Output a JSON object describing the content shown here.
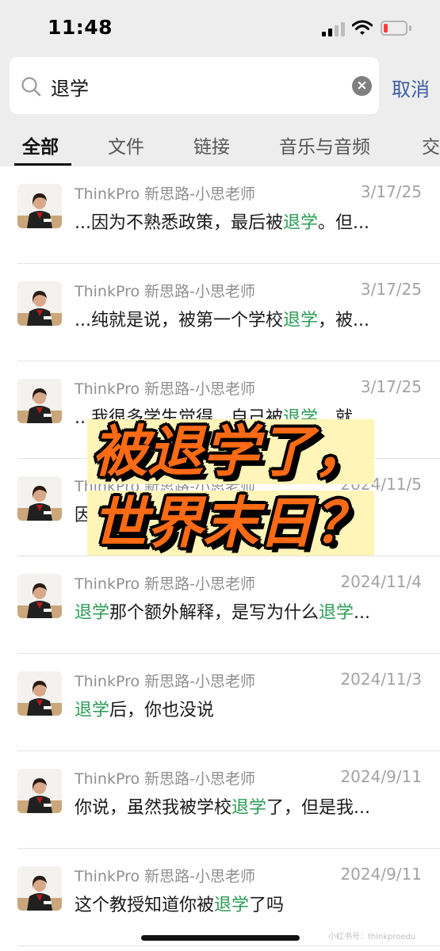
{
  "status_bar": {
    "time": "11:48"
  },
  "search": {
    "query": "退学",
    "cancel_label": "取消"
  },
  "tabs": [
    {
      "label": "全部",
      "active": true
    },
    {
      "label": "文件",
      "active": false
    },
    {
      "label": "链接",
      "active": false
    },
    {
      "label": "音乐与音频",
      "active": false
    },
    {
      "label": "交",
      "active": false
    }
  ],
  "results": [
    {
      "name": "ThinkPro 新思路-小思老师",
      "date": "3/17/25",
      "snippet": [
        {
          "t": "...因为不熟悉政策，最后被"
        },
        {
          "t": "退学",
          "hl": true
        },
        {
          "t": "。但..."
        }
      ]
    },
    {
      "name": "ThinkPro 新思路-小思老师",
      "date": "3/17/25",
      "snippet": [
        {
          "t": "...纯就是说，被第一个学校"
        },
        {
          "t": "退学",
          "hl": true
        },
        {
          "t": "，被..."
        }
      ]
    },
    {
      "name": "ThinkPro 新思路-小思老师",
      "date": "3/17/25",
      "snippet": [
        {
          "t": "...我很多学生觉得，自己被"
        },
        {
          "t": "退学",
          "hl": true
        },
        {
          "t": "，就..."
        }
      ]
    },
    {
      "name": "ThinkPro 新思路-小思老师",
      "date": "2024/11/5",
      "snippet": [
        {
          "t": "因                                          了课"
        }
      ]
    },
    {
      "name": "ThinkPro 新思路-小思老师",
      "date": "2024/11/4",
      "snippet": [
        {
          "t": "退学",
          "hl": true
        },
        {
          "t": "那个额外解释，是写为什么"
        },
        {
          "t": "退学",
          "hl": true
        },
        {
          "t": "..."
        }
      ]
    },
    {
      "name": "ThinkPro 新思路-小思老师",
      "date": "2024/11/3",
      "snippet": [
        {
          "t": "退学",
          "hl": true
        },
        {
          "t": "后，你也没说"
        }
      ]
    },
    {
      "name": "ThinkPro 新思路-小思老师",
      "date": "2024/9/11",
      "snippet": [
        {
          "t": "你说，虽然我被学校"
        },
        {
          "t": "退学",
          "hl": true
        },
        {
          "t": "了，但是我..."
        }
      ]
    },
    {
      "name": "ThinkPro 新思路-小思老师",
      "date": "2024/9/11",
      "snippet": [
        {
          "t": "这个教授知道你被"
        },
        {
          "t": "退学",
          "hl": true
        },
        {
          "t": "了吗"
        }
      ]
    }
  ],
  "overlay": {
    "line1": "被退学了，",
    "line2": "世界末日？"
  },
  "watermark": "小红书号：thinkproedu",
  "colors": {
    "highlight": "#2a9d55",
    "overlay_text": "#ff6a14",
    "cancel": "#3b5ca8",
    "battery_low": "#ff3b30"
  }
}
